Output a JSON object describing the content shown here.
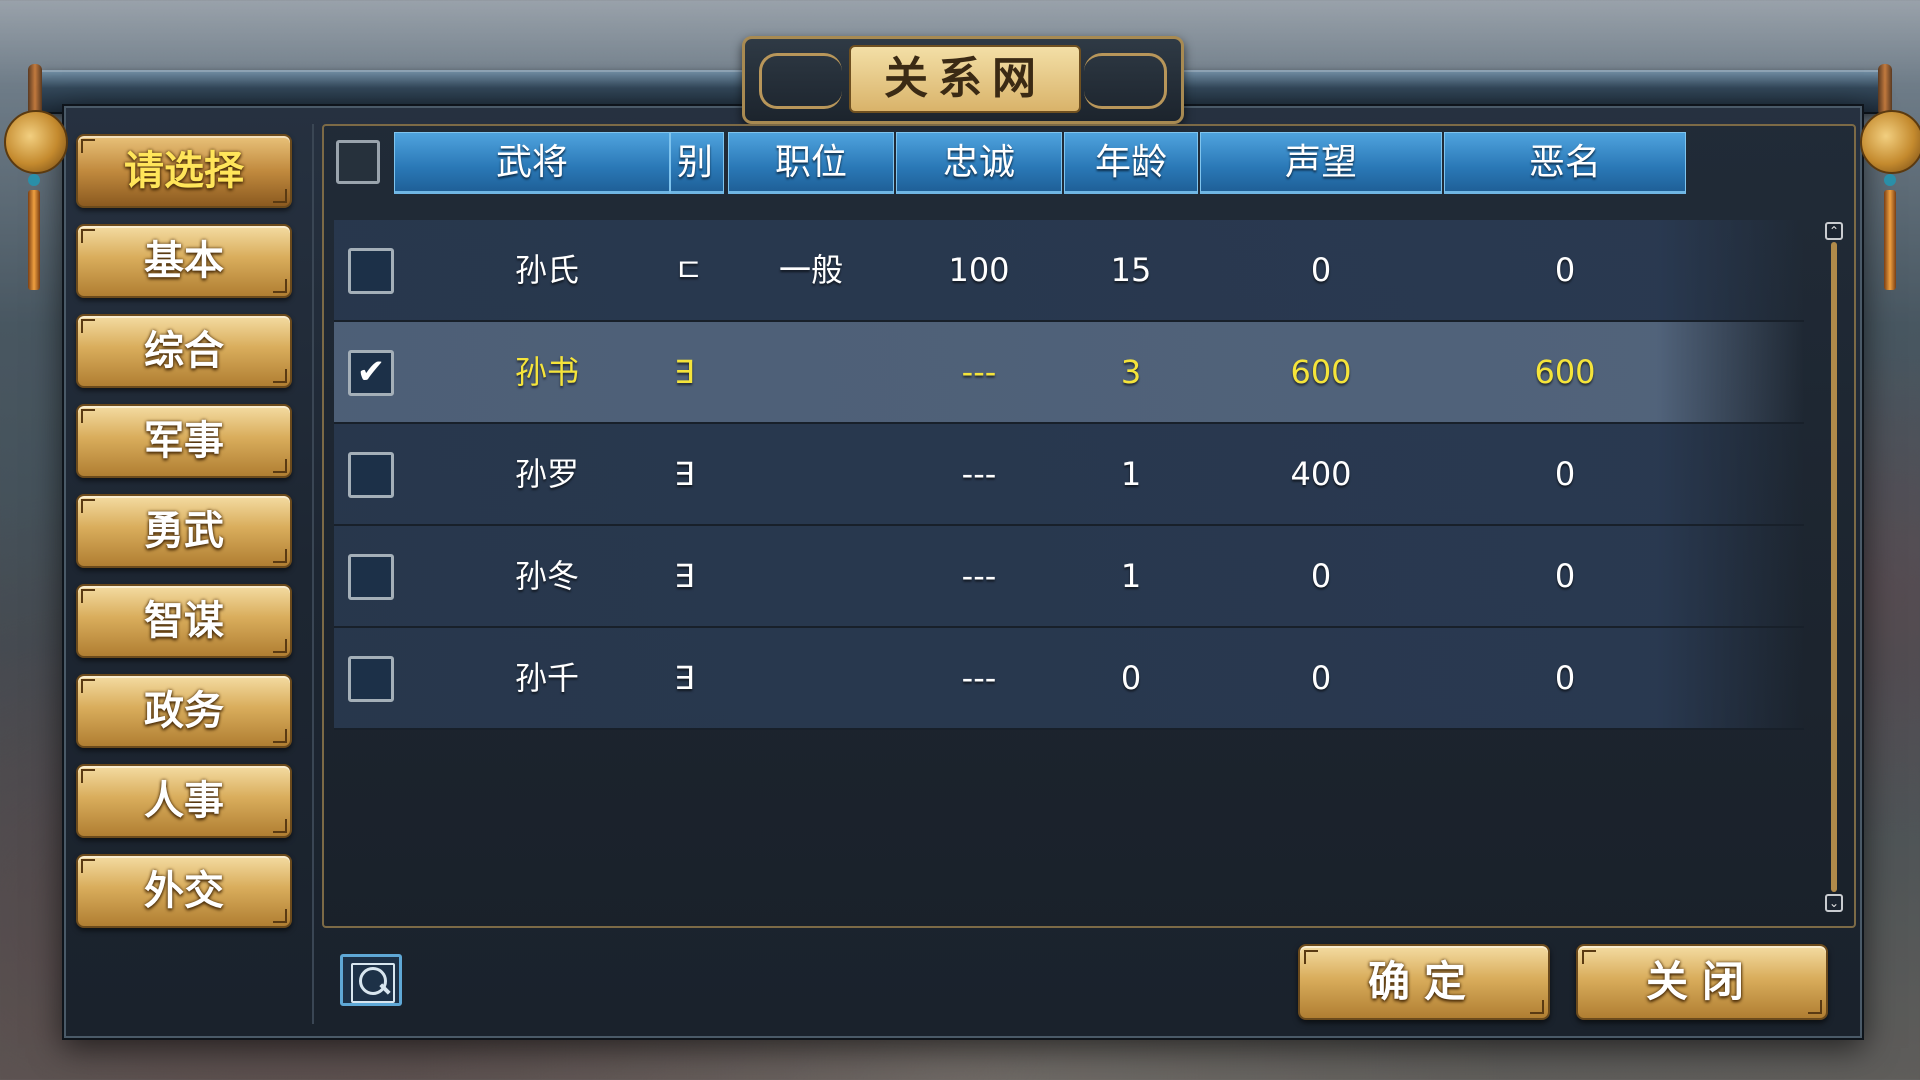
{
  "title": "关系网",
  "menu": {
    "items": [
      {
        "label": "请选择",
        "selected": true
      },
      {
        "label": "基本",
        "selected": false
      },
      {
        "label": "综合",
        "selected": false
      },
      {
        "label": "军事",
        "selected": false
      },
      {
        "label": "勇武",
        "selected": false
      },
      {
        "label": "智谋",
        "selected": false
      },
      {
        "label": "政务",
        "selected": false
      },
      {
        "label": "人事",
        "selected": false
      },
      {
        "label": "外交",
        "selected": false
      }
    ]
  },
  "table": {
    "columns": [
      "武将",
      "别",
      "职位",
      "忠诚",
      "年龄",
      "声望",
      "恶名"
    ],
    "rows": [
      {
        "checked": false,
        "name": "孙氏",
        "gender": "ㄷ",
        "position": "一般",
        "loyalty": "100",
        "age": "15",
        "fame": "0",
        "infamy": "0"
      },
      {
        "checked": true,
        "name": "孙书",
        "gender": "∃",
        "position": "",
        "loyalty": "---",
        "age": "3",
        "fame": "600",
        "infamy": "600"
      },
      {
        "checked": false,
        "name": "孙罗",
        "gender": "∃",
        "position": "",
        "loyalty": "---",
        "age": "1",
        "fame": "400",
        "infamy": "0"
      },
      {
        "checked": false,
        "name": "孙冬",
        "gender": "∃",
        "position": "",
        "loyalty": "---",
        "age": "1",
        "fame": "0",
        "infamy": "0"
      },
      {
        "checked": false,
        "name": "孙千",
        "gender": "∃",
        "position": "",
        "loyalty": "---",
        "age": "0",
        "fame": "0",
        "infamy": "0"
      }
    ]
  },
  "check_mark": "✔",
  "scroll": {
    "up": "⌃",
    "down": "⌄"
  },
  "buttons": {
    "confirm": "确定",
    "close": "关闭"
  },
  "icons": {
    "search": "search-icon"
  },
  "colors": {
    "highlight_text": "#f5e43a",
    "header_blue": "#2a78b6",
    "gold_button": "#d9ad5c"
  }
}
